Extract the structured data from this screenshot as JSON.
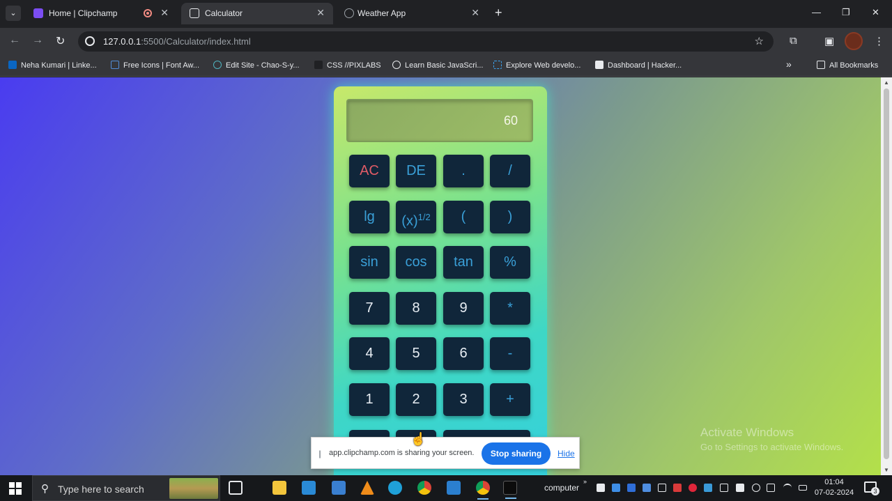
{
  "browser": {
    "tabs": [
      {
        "title": "Home | Clipchamp",
        "favicon": "clipchamp-icon",
        "recording": true
      },
      {
        "title": "Calculator",
        "favicon": "page-icon",
        "active": true
      },
      {
        "title": "Weather App",
        "favicon": "globe-icon"
      }
    ],
    "new_tab": "+",
    "window_controls": {
      "minimize": "—",
      "restore": "❐",
      "close": "✕"
    },
    "nav": {
      "back": "←",
      "forward": "→",
      "reload": "↻"
    },
    "url_host": "127.0.0.1",
    "url_path": ":5500/Calculator/index.html",
    "bookmark_star": "☆",
    "bookmarks": [
      {
        "label": "Neha Kumari | Linke...",
        "icon": "linkedin-icon",
        "color": "#0a66c2"
      },
      {
        "label": "Free Icons | Font Aw...",
        "icon": "fontawesome-icon",
        "color": "#528dd7"
      },
      {
        "label": "Edit Site - Chao-S-y...",
        "icon": "edit-site-icon",
        "color": "#4fb3bf"
      },
      {
        "label": "CSS //PIXLABS",
        "icon": "pixlabs-icon",
        "color": "#ffffff"
      },
      {
        "label": "Learn Basic JavaScri...",
        "icon": "javascript-icon",
        "color": "#e8eaed"
      },
      {
        "label": "Explore Web develo...",
        "icon": "web-dev-icon",
        "color": "#3ba3f0"
      },
      {
        "label": "Dashboard | Hacker...",
        "icon": "hackerrank-icon",
        "color": "#e8eaed"
      }
    ],
    "bookmarks_more": "»",
    "all_bookmarks": "All Bookmarks"
  },
  "calculator": {
    "display": "60",
    "rows": [
      [
        {
          "label": "AC",
          "style": "red"
        },
        {
          "label": "DE",
          "style": "op"
        },
        {
          "label": ".",
          "style": "op"
        },
        {
          "label": "/",
          "style": "op"
        }
      ],
      [
        {
          "label": "lg",
          "style": "op"
        },
        {
          "label": "(x)1/2",
          "style": "op"
        },
        {
          "label": "(",
          "style": "op"
        },
        {
          "label": ")",
          "style": "op"
        }
      ],
      [
        {
          "label": "sin",
          "style": "op"
        },
        {
          "label": "cos",
          "style": "op"
        },
        {
          "label": "tan",
          "style": "op"
        },
        {
          "label": "%",
          "style": "op"
        }
      ],
      [
        {
          "label": "7",
          "style": "num"
        },
        {
          "label": "8",
          "style": "num"
        },
        {
          "label": "9",
          "style": "num"
        },
        {
          "label": "*",
          "style": "op"
        }
      ],
      [
        {
          "label": "4",
          "style": "num"
        },
        {
          "label": "5",
          "style": "num"
        },
        {
          "label": "6",
          "style": "num"
        },
        {
          "label": "-",
          "style": "op"
        }
      ],
      [
        {
          "label": "1",
          "style": "num"
        },
        {
          "label": "2",
          "style": "num"
        },
        {
          "label": "3",
          "style": "num"
        },
        {
          "label": "+",
          "style": "op"
        }
      ]
    ]
  },
  "share_bar": {
    "message": "app.clipchamp.com is sharing your screen.",
    "stop": "Stop sharing",
    "hide": "Hide"
  },
  "watermark": {
    "line1": "Activate Windows",
    "line2": "Go to Settings to activate Windows."
  },
  "taskbar": {
    "search_placeholder": "Type here to search",
    "tray_label": "computer",
    "time": "01:04",
    "date": "07-02-2024",
    "notifications": "3"
  }
}
